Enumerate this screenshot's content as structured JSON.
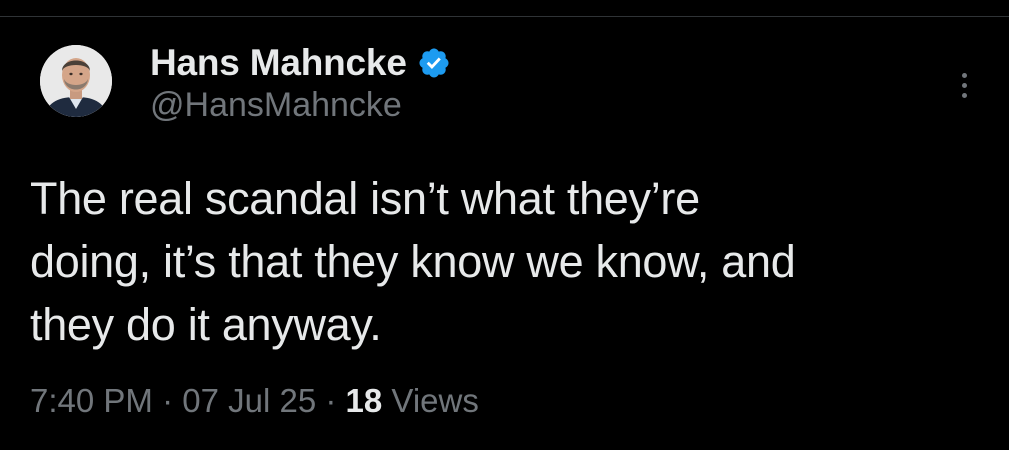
{
  "author": {
    "display_name": "Hans Mahncke",
    "handle": "@HansMahncke",
    "verified": true,
    "verified_icon": "verified-badge-icon",
    "avatar": "author-avatar"
  },
  "tweet": {
    "text": "The real scandal isn’t what they’re\ndoing, it’s that they know we know, and\nthey do it anyway.",
    "time": "7:40 PM",
    "separator": "·",
    "date": "07 Jul 25",
    "views_count": "18",
    "views_label": "Views"
  },
  "menu": {
    "icon": "more-vertical-icon"
  },
  "colors": {
    "background": "#000000",
    "primary_text": "#e7e9ea",
    "secondary_text": "#71767b",
    "verified_blue": "#1d9bf0"
  }
}
